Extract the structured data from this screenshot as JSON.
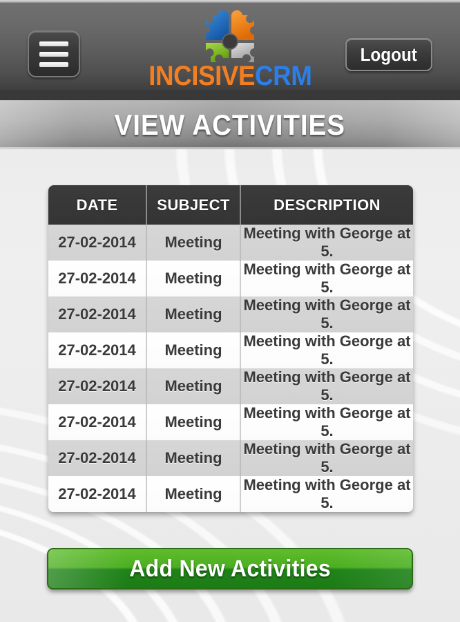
{
  "app": {
    "brand_primary": "INCISIVE",
    "brand_secondary": "CRM",
    "brand_primary_color": "#F57F20",
    "brand_secondary_color": "#2C7FE8",
    "logo_icon": "puzzle-gear-icon",
    "logo_colors": {
      "blue": "#1F6FC4",
      "orange": "#F07F17",
      "gray": "#BDBDBD",
      "green": "#7DBF23"
    }
  },
  "header": {
    "menu_icon": "hamburger-menu-icon",
    "logout_label": "Logout"
  },
  "title_bar": {
    "text": "VIEW ACTIVITIES"
  },
  "table": {
    "columns": [
      "DATE",
      "SUBJECT",
      "DESCRIPTION"
    ],
    "rows": [
      {
        "date": "27-02-2014",
        "subject": "Meeting",
        "description": "Meeting with George at 5."
      },
      {
        "date": "27-02-2014",
        "subject": "Meeting",
        "description": "Meeting with George at 5."
      },
      {
        "date": "27-02-2014",
        "subject": "Meeting",
        "description": "Meeting with George at 5."
      },
      {
        "date": "27-02-2014",
        "subject": "Meeting",
        "description": "Meeting with George at 5."
      },
      {
        "date": "27-02-2014",
        "subject": "Meeting",
        "description": "Meeting with George at 5."
      },
      {
        "date": "27-02-2014",
        "subject": "Meeting",
        "description": "Meeting with George at 5."
      },
      {
        "date": "27-02-2014",
        "subject": "Meeting",
        "description": "Meeting with George at 5."
      },
      {
        "date": "27-02-2014",
        "subject": "Meeting",
        "description": "Meeting with George at 5."
      }
    ]
  },
  "actions": {
    "add_label": "Add New Activities",
    "add_color": "#3a9e1e"
  }
}
